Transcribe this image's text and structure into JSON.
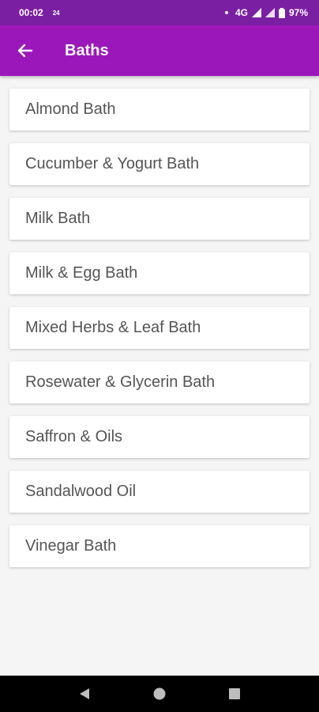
{
  "status_bar": {
    "time": "00:02",
    "sub": "24",
    "network": "4G",
    "battery": "97%"
  },
  "app_bar": {
    "title": "Baths",
    "back_icon": "arrow-back-icon",
    "bg_color": "#9c17ba"
  },
  "items": [
    {
      "label": "Almond Bath"
    },
    {
      "label": "Cucumber & Yogurt Bath"
    },
    {
      "label": "Milk Bath"
    },
    {
      "label": "Milk & Egg Bath"
    },
    {
      "label": "Mixed Herbs & Leaf Bath"
    },
    {
      "label": "Rosewater & Glycerin Bath"
    },
    {
      "label": "Saffron & Oils"
    },
    {
      "label": "Sandalwood Oil"
    },
    {
      "label": "Vinegar Bath"
    }
  ],
  "nav_bar": {
    "back_icon": "nav-back-triangle-icon",
    "home_icon": "nav-home-circle-icon",
    "recents_icon": "nav-recents-square-icon"
  }
}
